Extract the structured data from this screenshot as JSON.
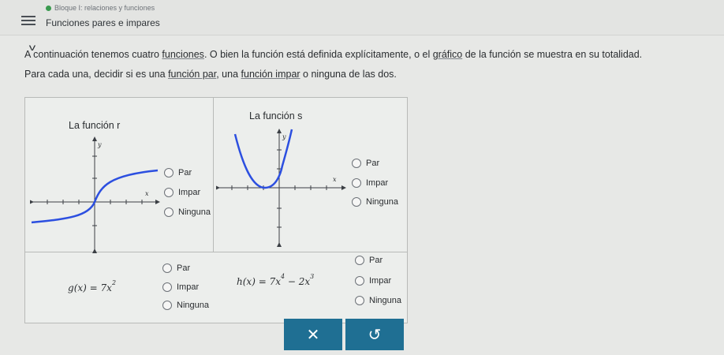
{
  "header": {
    "breadcrumb": "Bloque I: relaciones y funciones",
    "topic": "Funciones pares e impares"
  },
  "instructions": {
    "line1_a": "A continuación tenemos cuatro ",
    "line1_link1": "funciones",
    "line1_b": ". O bien la función está definida explícitamente, o el ",
    "line1_link2": "gráfico",
    "line1_c": " de la función se muestra en su totalidad.",
    "line2_a": "Para cada una, decidir si es una ",
    "line2_link1": "función par",
    "line2_b": ", una ",
    "line2_link2": "función impar",
    "line2_c": " o ninguna de las dos."
  },
  "cells": {
    "r": {
      "title": "La función r",
      "axis_x": "x",
      "axis_y": "y"
    },
    "s": {
      "title": "La función s",
      "axis_x": "x",
      "axis_y": "y"
    },
    "g": {
      "name": "g",
      "arg": "x",
      "eq": "= 7x",
      "exp": "2"
    },
    "h": {
      "name": "h",
      "arg": "x",
      "eq": "= 7x",
      "exp1": "4",
      "minus": " − 2x",
      "exp2": "3"
    }
  },
  "options": {
    "par": "Par",
    "impar": "Impar",
    "ninguna": "Ninguna"
  },
  "buttons": {
    "clear": "✕",
    "undo": "↺"
  },
  "colors": {
    "curve": "#2c4fe0",
    "button_bg": "#1f6f93",
    "status_dot": "#3a9a4f"
  }
}
